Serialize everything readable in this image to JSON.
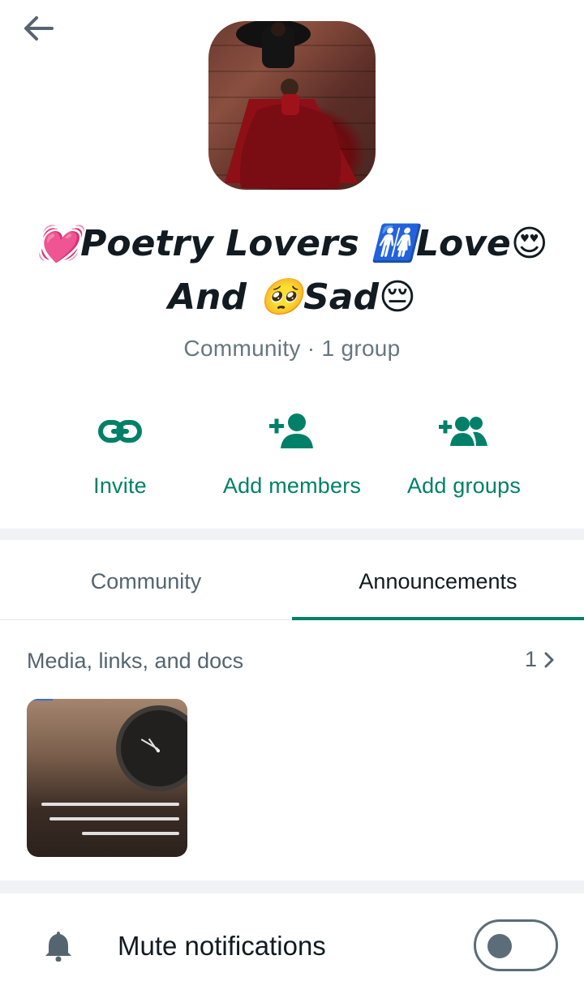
{
  "header": {
    "back_icon": "arrow-left-icon"
  },
  "community": {
    "avatar_desc": "community-photo",
    "title": "💓Poetry Lovers 🚻Love😍 And 🥺Sad😔",
    "subtitle": "Community · 1 group"
  },
  "actions": [
    {
      "label": "Invite",
      "icon": "link-icon"
    },
    {
      "label": "Add members",
      "icon": "add-person-icon"
    },
    {
      "label": "Add groups",
      "icon": "add-group-icon"
    }
  ],
  "tabs": [
    {
      "label": "Community",
      "active": false
    },
    {
      "label": "Announcements",
      "active": true
    }
  ],
  "media": {
    "title": "Media, links, and docs",
    "count": "1"
  },
  "settings": {
    "mute_label": "Mute notifications",
    "mute_enabled": false
  },
  "colors": {
    "accent": "#008069",
    "text": "#111b21",
    "muted": "#667781"
  }
}
